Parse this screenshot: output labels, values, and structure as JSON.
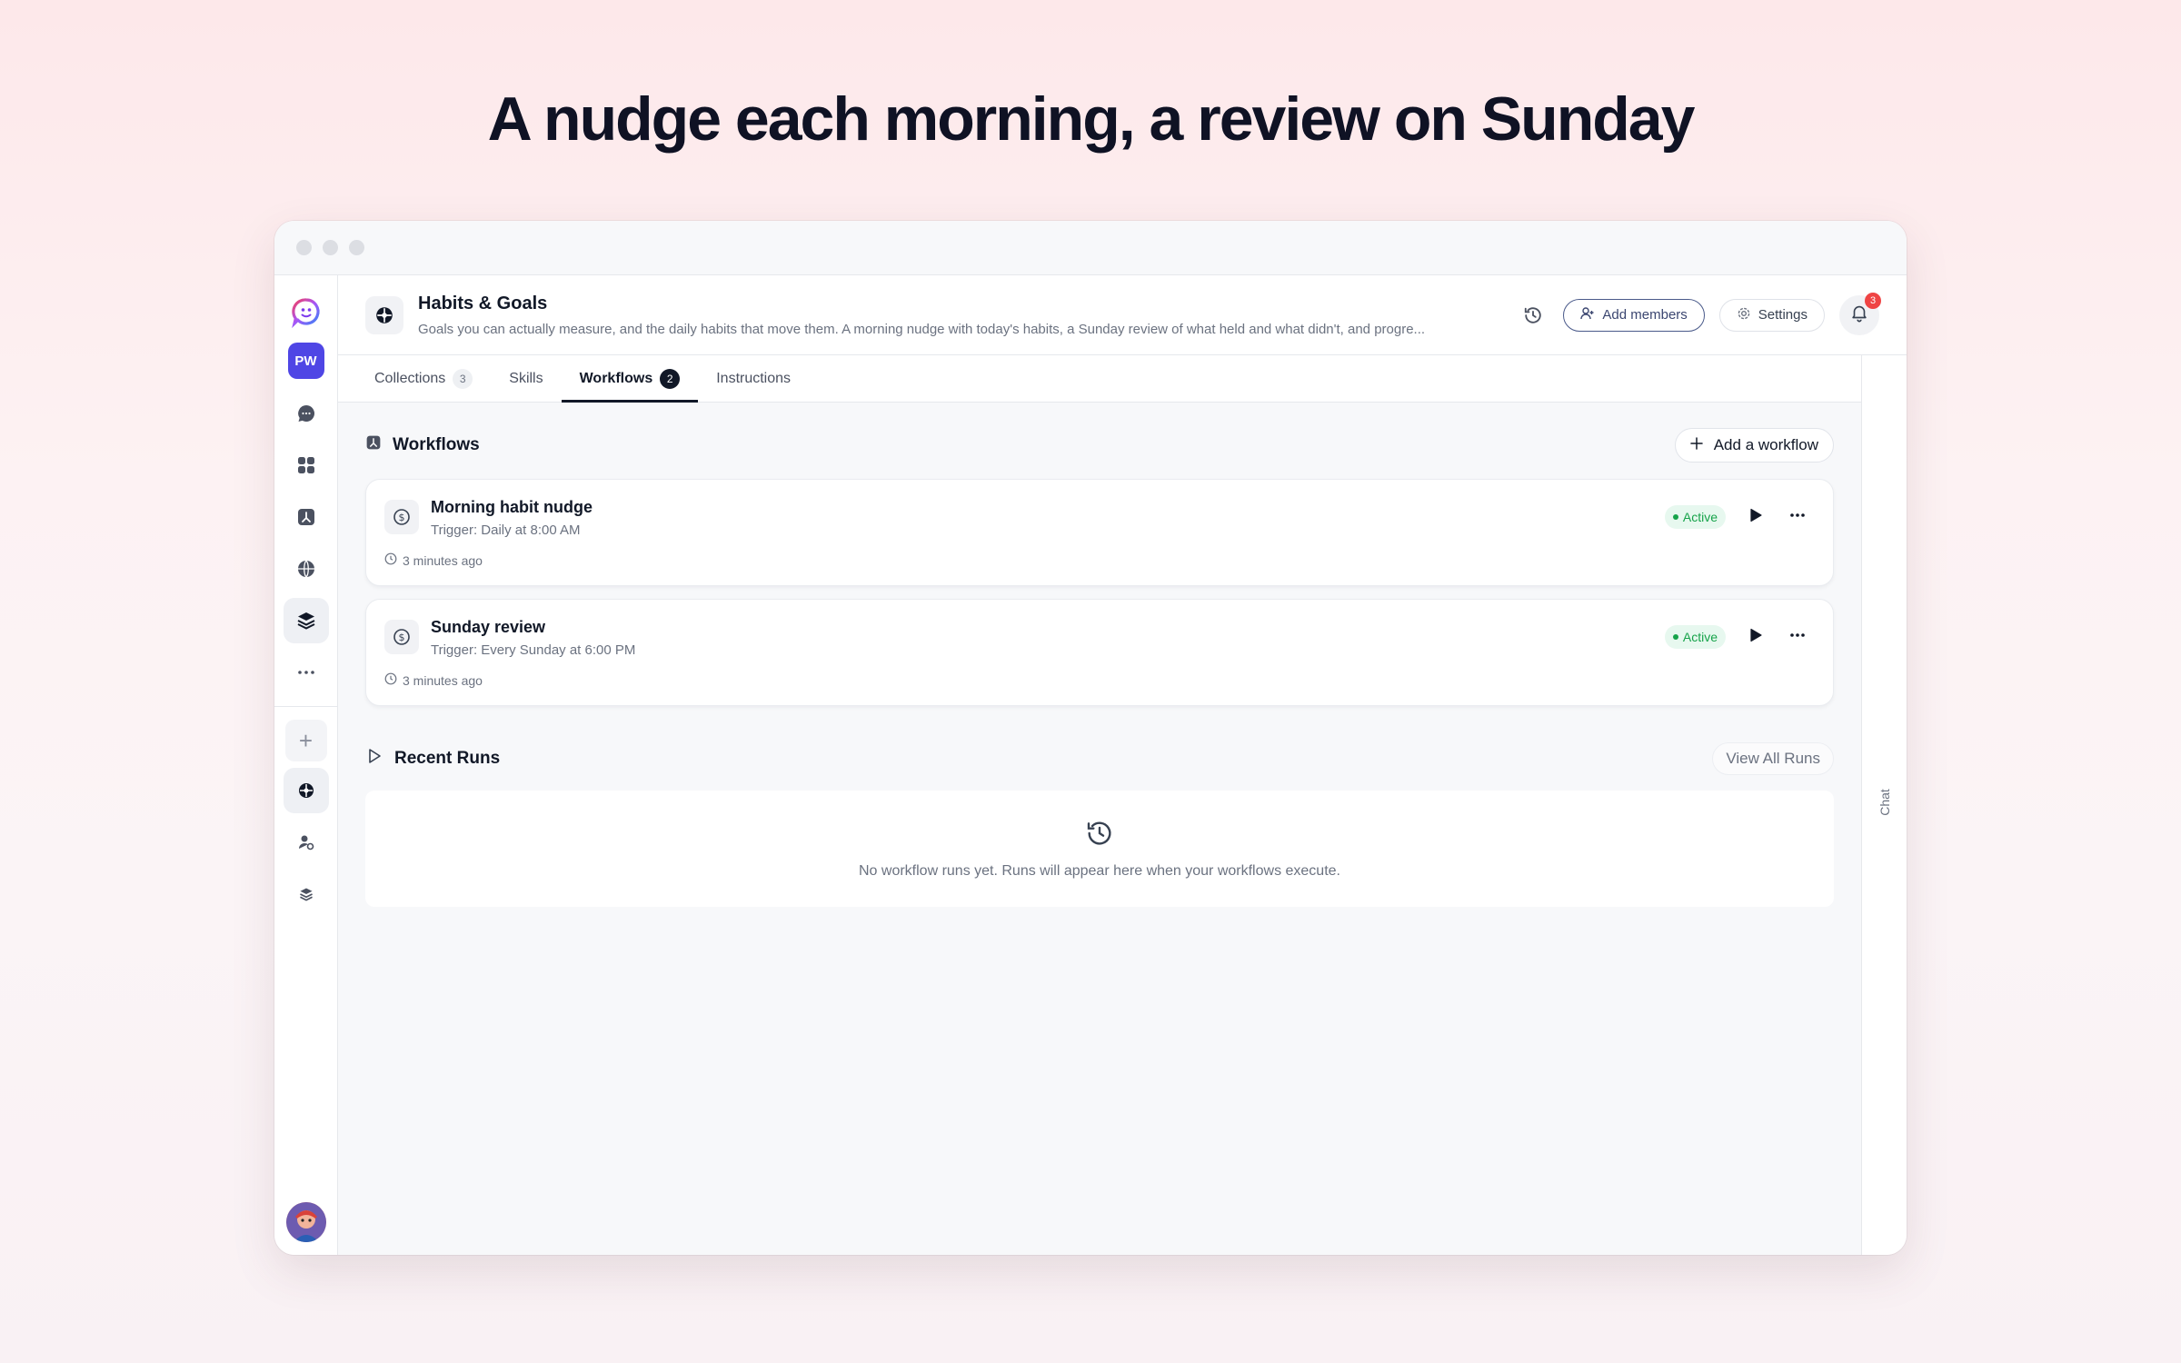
{
  "hero_title": "A nudge each morning, a review on Sunday",
  "rail": {
    "workspace_initials": "PW",
    "accent": "#4f46e5"
  },
  "header": {
    "title": "Habits & Goals",
    "description": "Goals you can actually measure, and the daily habits that move them. A morning nudge with today's habits, a Sunday review of what held and what didn't, and progre...",
    "add_members_label": "Add members",
    "settings_label": "Settings",
    "notification_count": "3"
  },
  "tabs": [
    {
      "label": "Collections",
      "count": "3"
    },
    {
      "label": "Skills"
    },
    {
      "label": "Workflows",
      "count": "2"
    },
    {
      "label": "Instructions"
    }
  ],
  "workflows_section": {
    "title": "Workflows",
    "add_label": "Add a workflow",
    "items": [
      {
        "name": "Morning habit nudge",
        "trigger": "Trigger: Daily at 8:00 AM",
        "time": "3 minutes ago",
        "status": "Active"
      },
      {
        "name": "Sunday review",
        "trigger": "Trigger: Every Sunday at 6:00 PM",
        "time": "3 minutes ago",
        "status": "Active"
      }
    ]
  },
  "recent_runs": {
    "title": "Recent Runs",
    "view_all_label": "View All Runs",
    "empty_text": "No workflow runs yet. Runs will appear here when your workflows execute."
  },
  "chat_label": "Chat",
  "colors": {
    "active_green": "#16a34a",
    "badge_red": "#ef4444",
    "dark": "#111827"
  }
}
